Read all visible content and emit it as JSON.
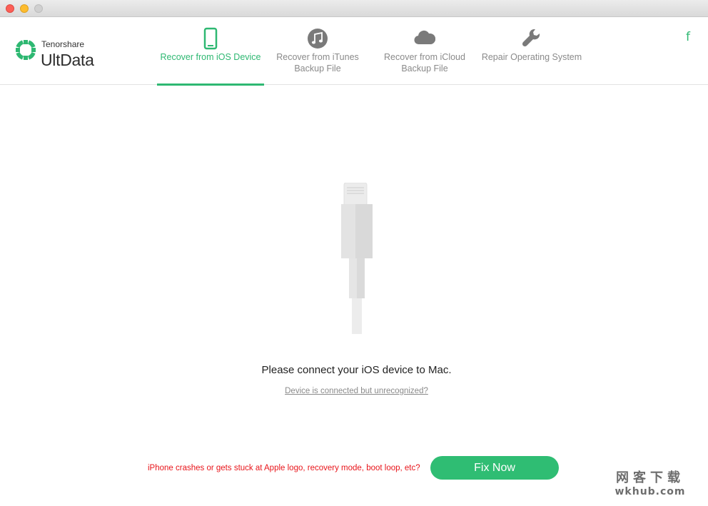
{
  "brand": {
    "company": "Tenorshare",
    "product": "UltData",
    "accent_color": "#2eb872"
  },
  "tabs": [
    {
      "label": "Recover from iOS Device",
      "icon": "iphone-icon",
      "active": true
    },
    {
      "label": "Recover from iTunes Backup File",
      "icon": "music-note-icon",
      "active": false
    },
    {
      "label": "Recover from iCloud Backup File",
      "icon": "cloud-icon",
      "active": false
    },
    {
      "label": "Repair Operating System",
      "icon": "wrench-icon",
      "active": false
    }
  ],
  "header": {
    "social_label": "f",
    "social_icon": "facebook-icon"
  },
  "main": {
    "prompt": "Please connect your iOS device to Mac.",
    "help_link": "Device is connected but unrecognized?",
    "illustration": "lightning-cable-icon"
  },
  "footer": {
    "crash_text": "iPhone crashes or gets stuck at Apple logo, recovery mode, boot loop, etc?",
    "fix_button": "Fix Now",
    "crash_text_color": "#e8141a"
  },
  "watermark": {
    "line1": "网客下载",
    "line2": "wkhub.com"
  }
}
